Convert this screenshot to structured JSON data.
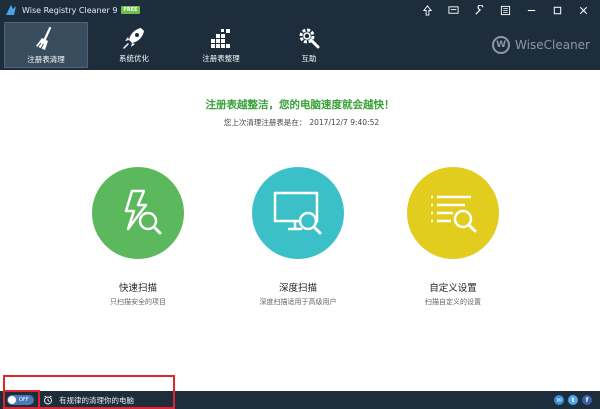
{
  "window": {
    "title": "Wise Registry Cleaner 9",
    "badge": "FREE"
  },
  "toolbar": {
    "tabs": [
      {
        "label": "注册表清理",
        "icon": "broom-icon",
        "active": true
      },
      {
        "label": "系统优化",
        "icon": "rocket-icon",
        "active": false
      },
      {
        "label": "注册表整理",
        "icon": "defrag-blocks-icon",
        "active": false
      },
      {
        "label": "互助",
        "icon": "gear-wrench-icon",
        "active": false
      }
    ],
    "brand": "WiseCleaner",
    "brand_initial": "W"
  },
  "main": {
    "headline": "注册表越整洁，您的电脑速度就会越快！",
    "last_clean_label": "您上次清理注册表是在：",
    "last_clean_time": "2017/12/7 9:40:52",
    "options": [
      {
        "title": "快速扫描",
        "desc": "只扫描安全的项目",
        "icon": "lightning-search-icon",
        "color": "#5cb85c"
      },
      {
        "title": "深度扫描",
        "desc": "深度扫描适用于高级用户",
        "icon": "monitor-search-icon",
        "color": "#3cc0c8"
      },
      {
        "title": "自定义设置",
        "desc": "扫描自定义的设置",
        "icon": "list-search-icon",
        "color": "#e2cc1e"
      }
    ]
  },
  "bottom": {
    "toggle_state": "OFF",
    "schedule_text": "有规律的清理你的电脑",
    "social": [
      "mail-icon",
      "twitter-icon",
      "facebook-icon"
    ]
  },
  "colors": {
    "bar_bg": "#1e2d3c",
    "headline_green": "#3aa23a",
    "highlight_red": "#e0262d"
  }
}
